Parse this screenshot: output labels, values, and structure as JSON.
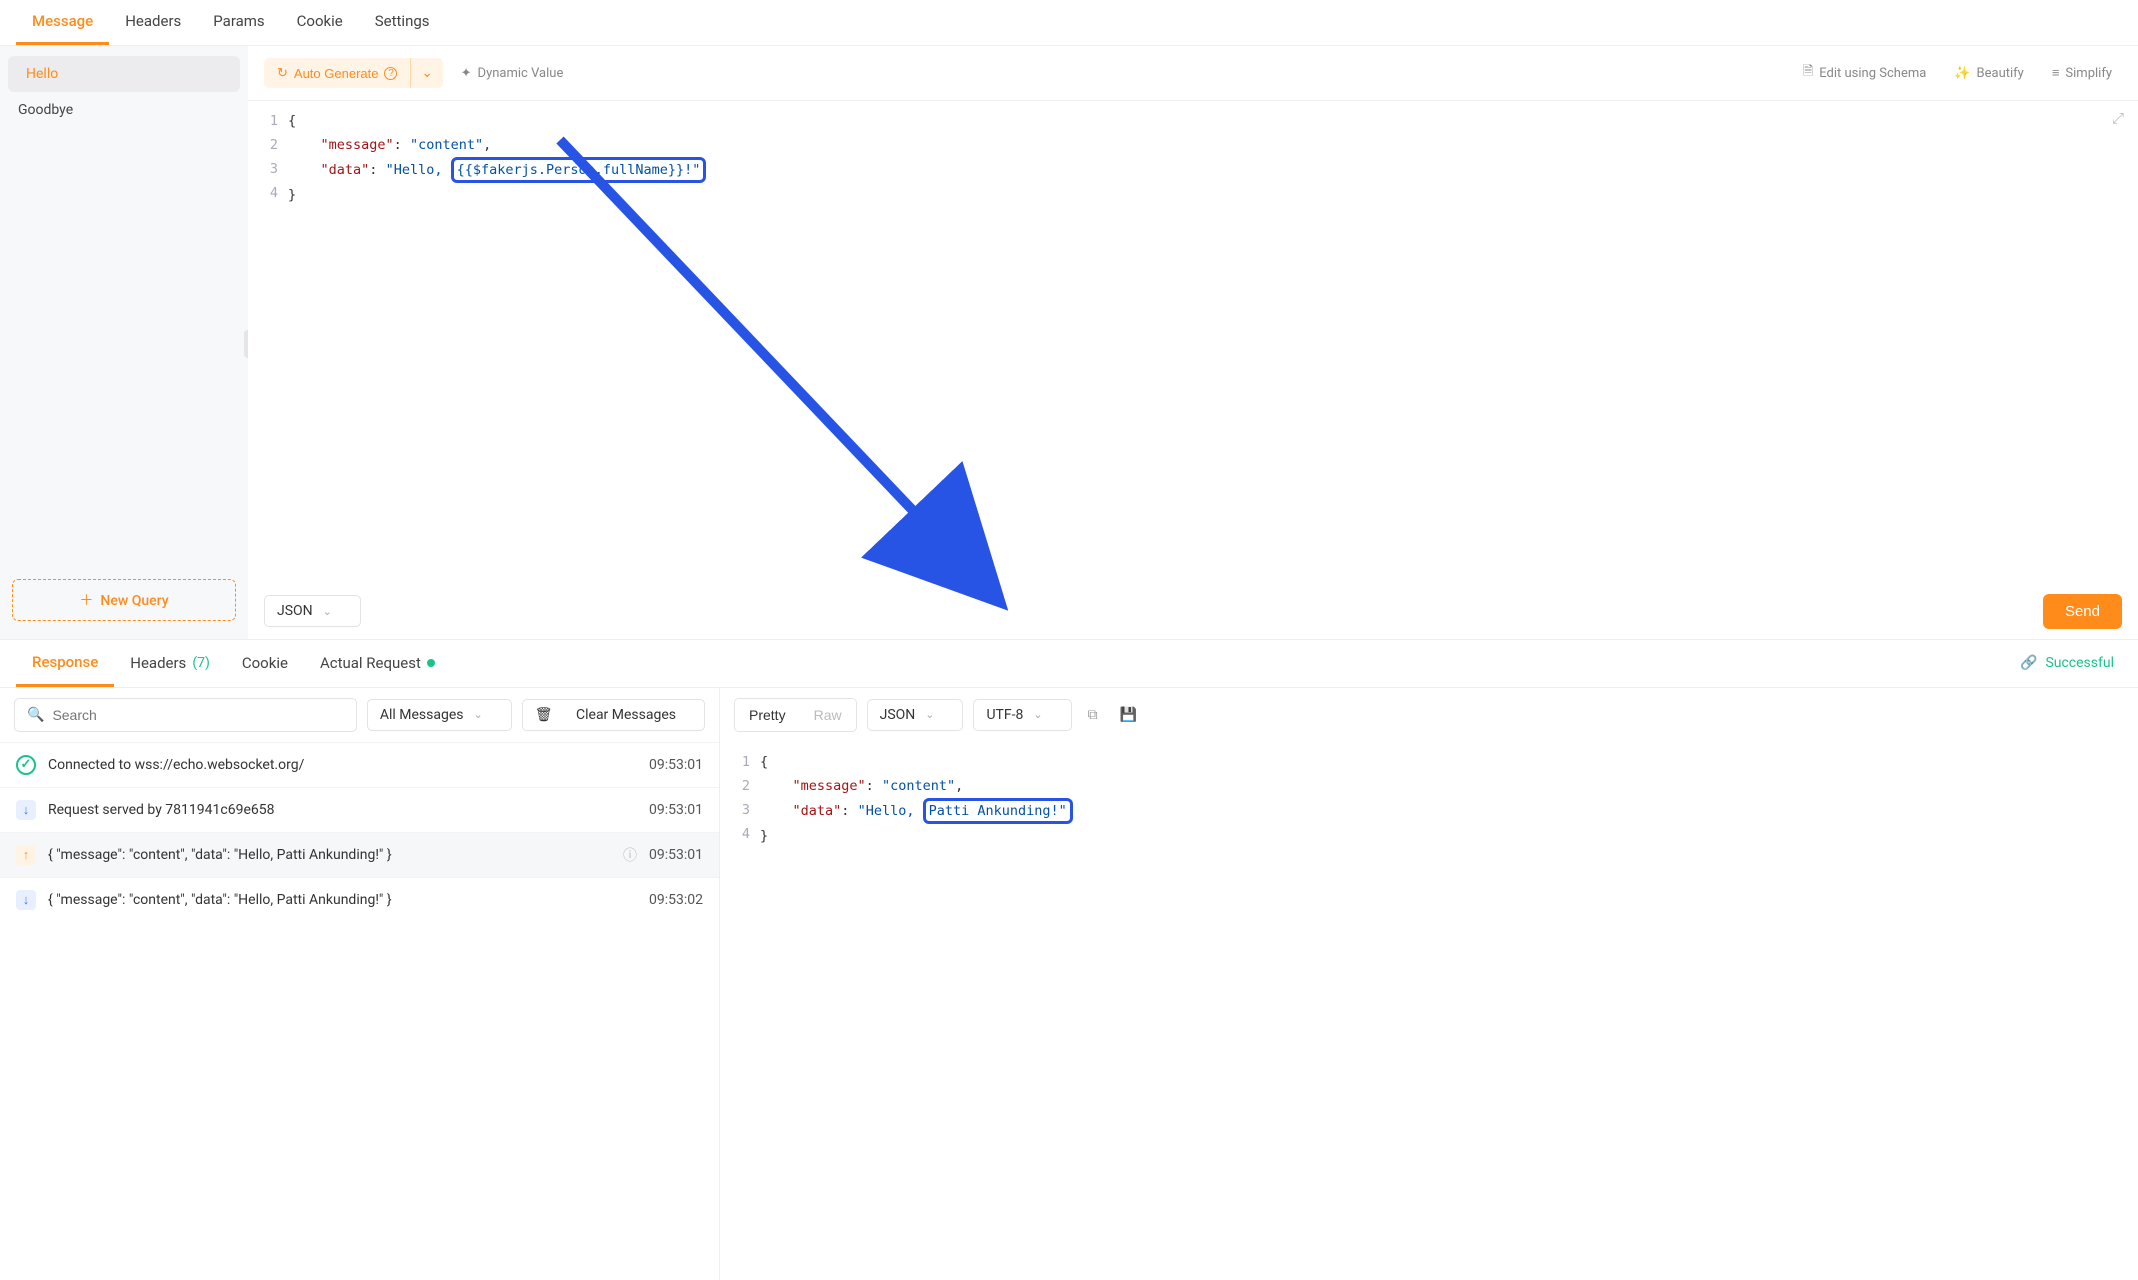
{
  "tabs": {
    "message": "Message",
    "headers": "Headers",
    "params": "Params",
    "cookie": "Cookie",
    "settings": "Settings"
  },
  "sidebar": {
    "items": [
      {
        "label": "Hello",
        "active": true
      },
      {
        "label": "Goodbye",
        "active": false
      }
    ],
    "new_query": "New Query"
  },
  "toolbar": {
    "auto_generate": "Auto Generate",
    "dynamic_value": "Dynamic Value",
    "edit_schema": "Edit using Schema",
    "beautify": "Beautify",
    "simplify": "Simplify"
  },
  "editor": {
    "lines": [
      "1",
      "2",
      "3",
      "4"
    ],
    "line2_key": "\"message\"",
    "line2_val": "\"content\"",
    "line3_key": "\"data\"",
    "line3_val_prefix": "\"Hello, ",
    "line3_val_box": "{{$fakerjs.Person.fullName}}!\"",
    "format_select": "JSON",
    "send": "Send"
  },
  "response": {
    "tabs": {
      "response": "Response",
      "headers": "Headers",
      "headers_count": "(7)",
      "cookie": "Cookie",
      "actual_request": "Actual Request"
    },
    "status": "Successful",
    "search_placeholder": "Search",
    "filter": "All Messages",
    "clear": "Clear Messages",
    "messages": [
      {
        "icon": "ok",
        "text": "Connected to wss://echo.websocket.org/",
        "time": "09:53:01"
      },
      {
        "icon": "down",
        "text": "Request served by 7811941c69e658",
        "time": "09:53:01"
      },
      {
        "icon": "up",
        "text": "{ \"message\": \"content\", \"data\": \"Hello, Patti Ankunding!\" }",
        "time": "09:53:01",
        "help": true,
        "sel": true
      },
      {
        "icon": "down",
        "text": "{ \"message\": \"content\", \"data\": \"Hello, Patti Ankunding!\" }",
        "time": "09:53:02"
      }
    ],
    "viewer": {
      "pretty": "Pretty",
      "raw": "Raw",
      "format": "JSON",
      "encoding": "UTF-8",
      "lines": [
        "1",
        "2",
        "3",
        "4"
      ],
      "line2_key": "\"message\"",
      "line2_val": "\"content\"",
      "line3_key": "\"data\"",
      "line3_val_prefix": "\"Hello, ",
      "line3_val_box": "Patti Ankunding!\""
    }
  }
}
